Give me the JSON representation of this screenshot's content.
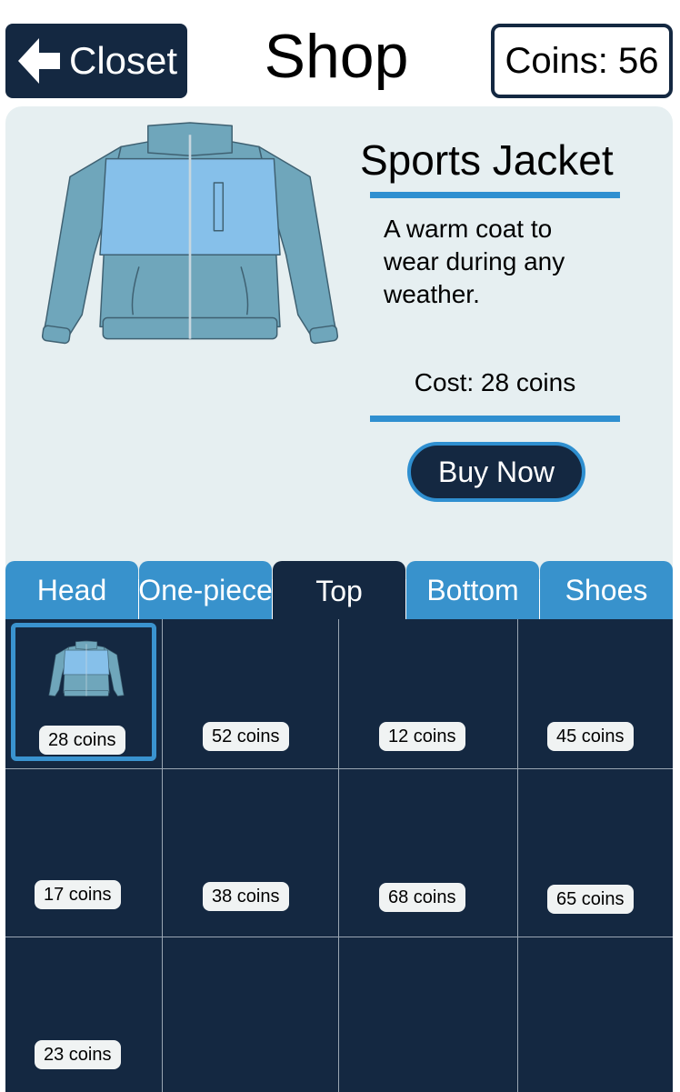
{
  "header": {
    "back_label": "Closet",
    "title": "Shop",
    "coins_label": "Coins: 56"
  },
  "detail": {
    "name": "Sports Jacket",
    "description": "A warm coat to wear during any weather.",
    "cost": "Cost: 28 coins",
    "buy_label": "Buy Now"
  },
  "tabs": [
    {
      "label": "Head"
    },
    {
      "label": "One-piece"
    },
    {
      "label": "Top"
    },
    {
      "label": "Bottom"
    },
    {
      "label": "Shoes"
    }
  ],
  "active_tab": "Top",
  "grid": {
    "items": [
      {
        "price": "28 coins",
        "selected": true,
        "icon": "jacket-icon"
      },
      {
        "price": "52 coins"
      },
      {
        "price": "12 coins"
      },
      {
        "price": "45 coins"
      },
      {
        "price": "17 coins"
      },
      {
        "price": "38 coins"
      },
      {
        "price": "68 coins"
      },
      {
        "price": "65 coins"
      },
      {
        "price": "23 coins"
      }
    ]
  },
  "colors": {
    "navy": "#142841",
    "accent_blue": "#2f8fd0",
    "tab_blue": "#3892cc",
    "panel_bg": "#e6eff1",
    "jacket_body": "#6fa6bb",
    "jacket_panel": "#86c0ea"
  }
}
